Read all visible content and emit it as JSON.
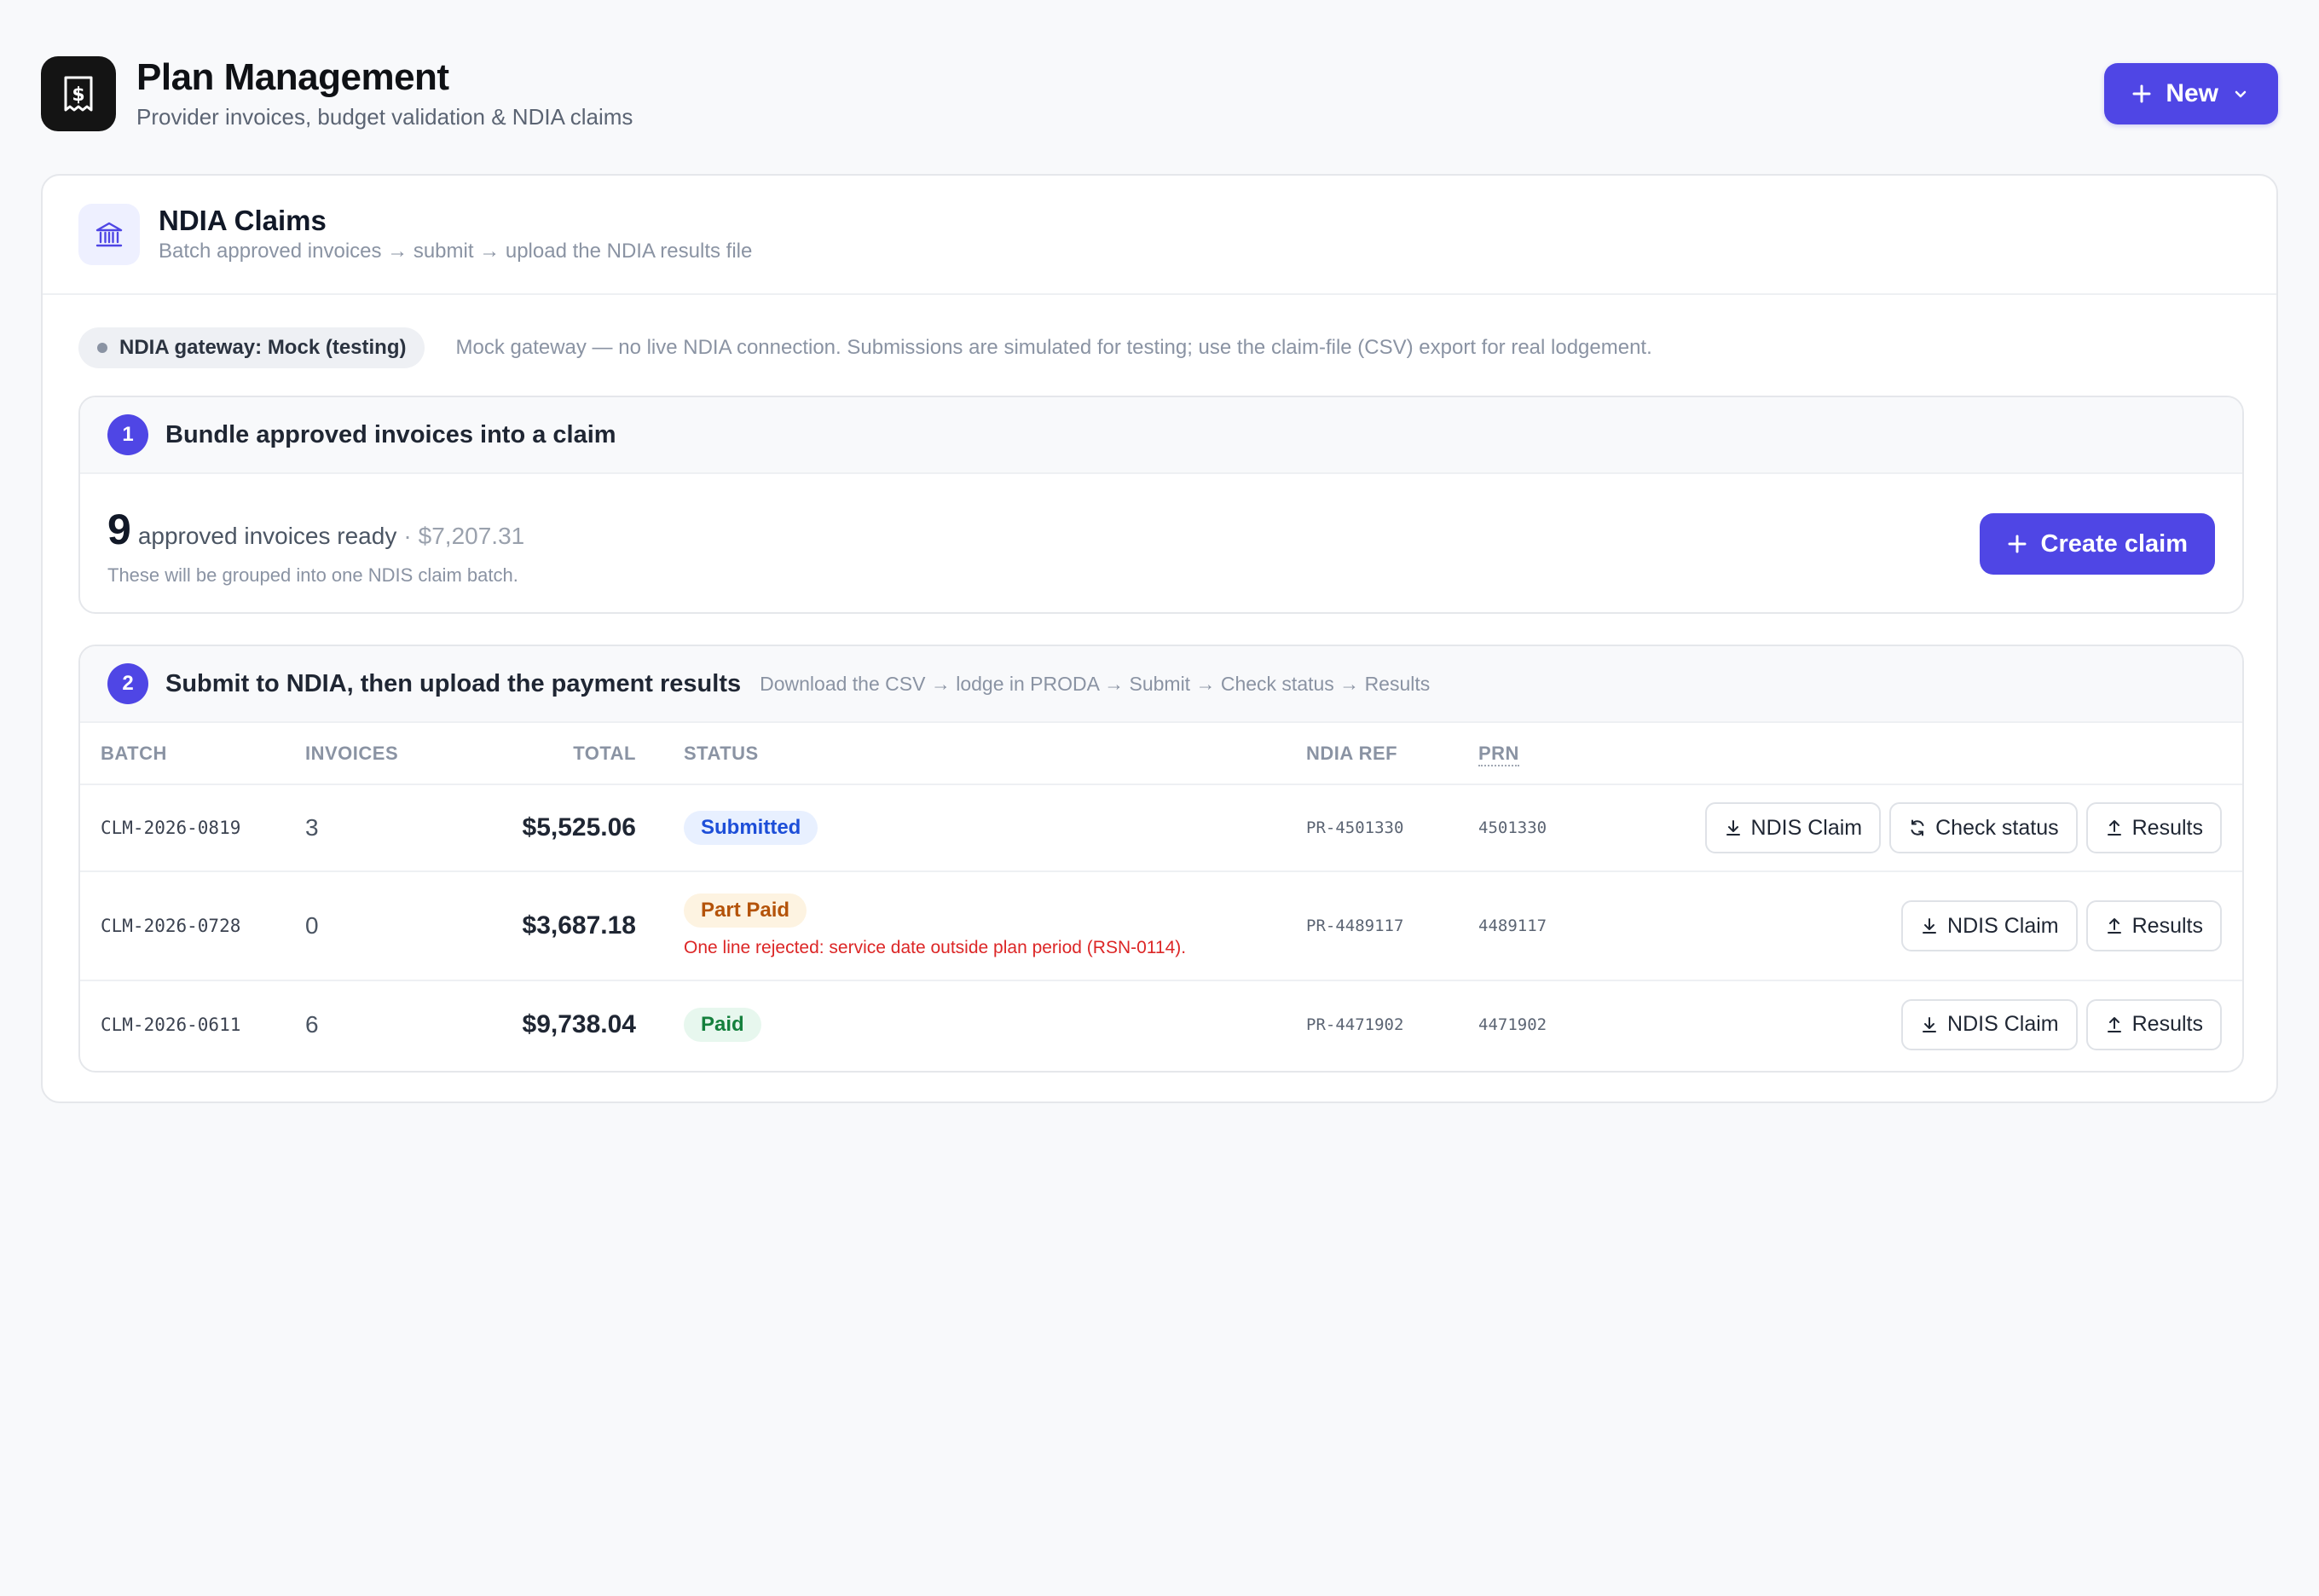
{
  "header": {
    "title": "Plan Management",
    "subtitle": "Provider invoices, budget validation & NDIA claims",
    "new_label": "New"
  },
  "card": {
    "title": "NDIA Claims",
    "subtitle": "Batch approved invoices → submit → upload the NDIA results file"
  },
  "gateway": {
    "label": "NDIA gateway: Mock (testing)",
    "note": "Mock gateway — no live NDIA connection. Submissions are simulated for testing; use the claim-file (CSV) export for real lodgement."
  },
  "step1": {
    "number": "1",
    "title": "Bundle approved invoices into a claim",
    "count": "9",
    "ready_text": "approved invoices ready",
    "separator": "·",
    "amount": "$7,207.31",
    "note": "These will be grouped into one NDIS claim batch.",
    "button": "Create claim"
  },
  "step2": {
    "number": "2",
    "title": "Submit to NDIA, then upload the payment results",
    "hint": "Download the CSV → lodge in PRODA → Submit → Check status → Results",
    "columns": {
      "batch": "BATCH",
      "invoices": "INVOICES",
      "total": "TOTAL",
      "status": "STATUS",
      "ref": "NDIA REF",
      "prn": "PRN"
    },
    "rows": [
      {
        "batch": "CLM-2026-0819",
        "invoices": "3",
        "total": "$5,525.06",
        "status": "Submitted",
        "ref": "PR-4501330",
        "prn": "4501330",
        "actions": [
          "NDIS Claim",
          "Check status",
          "Results"
        ]
      },
      {
        "batch": "CLM-2026-0728",
        "invoices": "0",
        "total": "$3,687.18",
        "status": "Part Paid",
        "error": "One line rejected: service date outside plan period (RSN-0114).",
        "ref": "PR-4489117",
        "prn": "4489117",
        "actions": [
          "NDIS Claim",
          "Results"
        ]
      },
      {
        "batch": "CLM-2026-0611",
        "invoices": "6",
        "total": "$9,738.04",
        "status": "Paid",
        "ref": "PR-4471902",
        "prn": "4471902",
        "actions": [
          "NDIS Claim",
          "Results"
        ]
      }
    ]
  },
  "colors": {
    "accent": "#4f46e5",
    "submitted": "#1d4ed8",
    "part_paid": "#b45309",
    "paid": "#15803d",
    "error": "#dc2626"
  },
  "icons": {
    "logo": "receipt-dollar-icon",
    "card": "bank-icon",
    "download": "download-icon",
    "refresh": "refresh-icon",
    "upload": "upload-icon"
  }
}
